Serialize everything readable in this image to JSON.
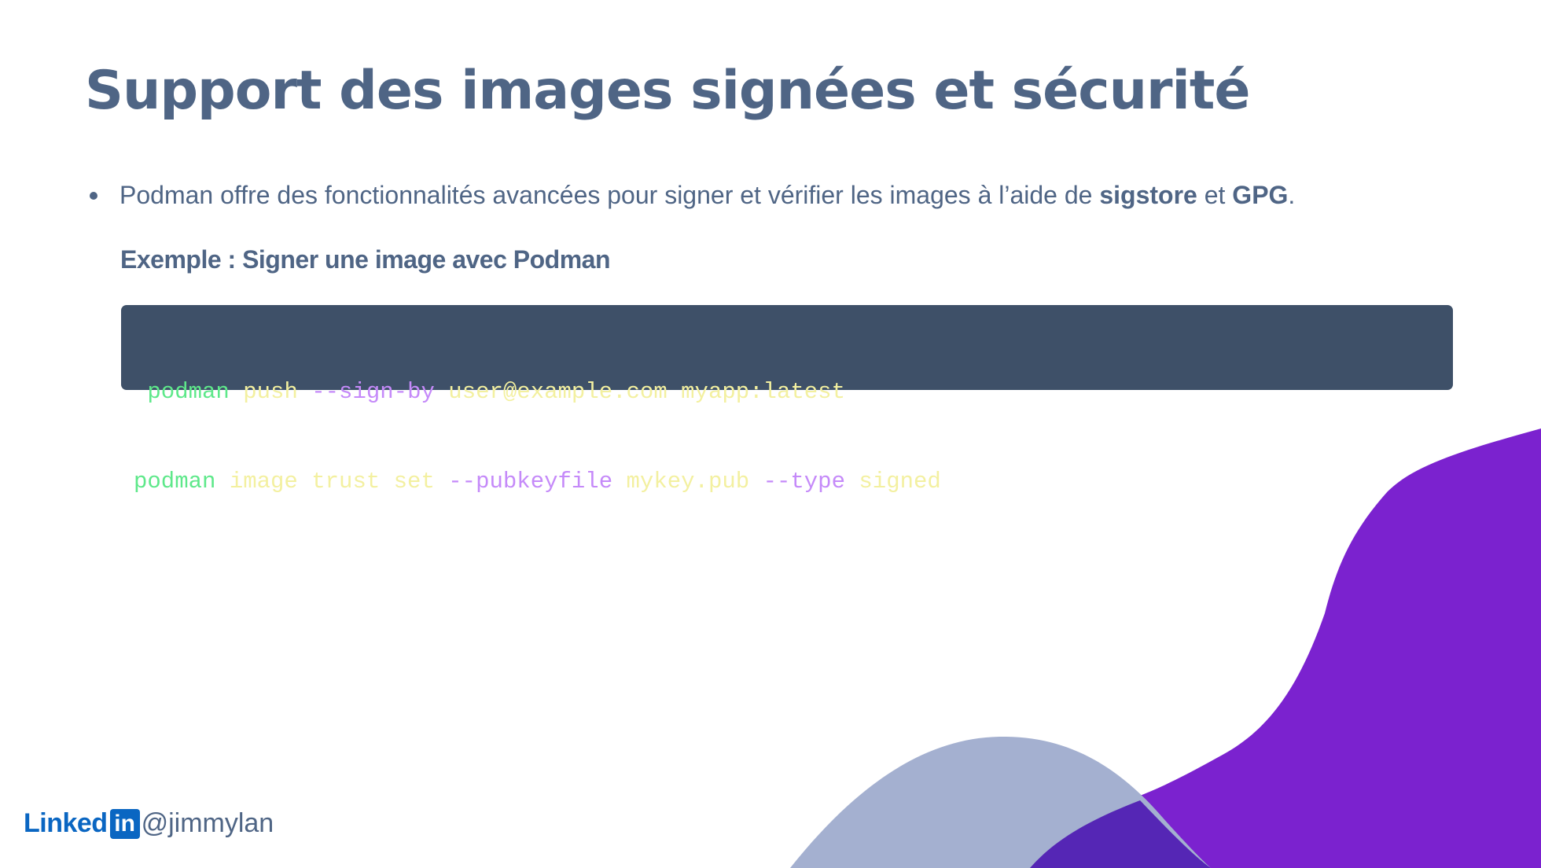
{
  "slide": {
    "title": "Support des images signées et sécurité"
  },
  "bullet": {
    "text_before": "Podman offre des fonctionnalités avancées pour signer et vérifier les images à l’aide de ",
    "bold_1": "sigstore",
    "text_middle": " et ",
    "bold_2": "GPG",
    "text_after": "."
  },
  "example": {
    "heading": "Exemple : Signer une image avec Podman"
  },
  "code": {
    "lines": [
      {
        "tokens": [
          {
            "text": " podman",
            "kind": "cmd"
          },
          {
            "text": " push ",
            "kind": "arg"
          },
          {
            "text": "--sign-by",
            "kind": "flag"
          },
          {
            "text": " user@example.com myapp:latest",
            "kind": "arg"
          }
        ]
      },
      {
        "tokens": [
          {
            "text": "podman",
            "kind": "cmd"
          },
          {
            "text": " image trust set ",
            "kind": "arg"
          },
          {
            "text": "--pubkeyfile",
            "kind": "flag"
          },
          {
            "text": " mykey.pub ",
            "kind": "arg"
          },
          {
            "text": "--type",
            "kind": "flag"
          },
          {
            "text": " signed",
            "kind": "arg"
          }
        ]
      }
    ]
  },
  "footer": {
    "brand_word": "Linked",
    "brand_box": "in",
    "handle": "@jimmylan"
  },
  "colors": {
    "title": "#4f6585",
    "code_bg": "#3e5068",
    "code_command": "#5ee88a",
    "code_argument": "#f3f0a0",
    "code_flag": "#c58af9",
    "linkedin_blue": "#0a66c2",
    "deco_purple": "#7b22cf",
    "deco_lavender": "#a4b0d0"
  }
}
